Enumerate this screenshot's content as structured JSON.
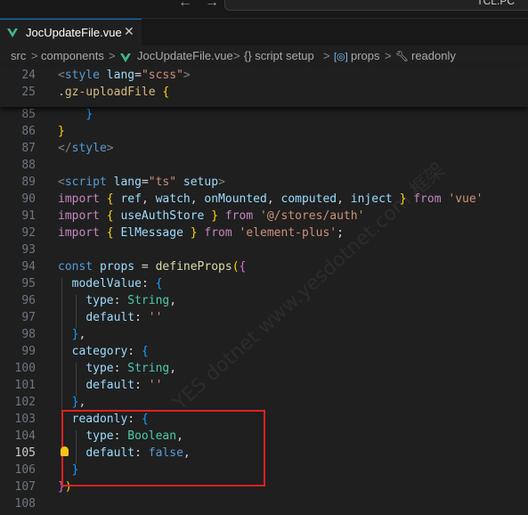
{
  "topbar": {
    "nav_back": "←",
    "nav_forward": "→",
    "command_text": "TCL.PC"
  },
  "tab": {
    "label": "JocUpdateFile.vue",
    "close": "✕"
  },
  "breadcrumb": {
    "segments": [
      "src",
      "components",
      "JocUpdateFile.vue",
      "{} script setup",
      "props",
      "readonly"
    ],
    "separator": ">"
  },
  "sticky_lines": [
    {
      "num": "24",
      "tokens": [
        [
          "t-punc",
          "<"
        ],
        [
          "t-tag",
          "style"
        ],
        [
          "t-plain",
          " "
        ],
        [
          "t-attr",
          "lang"
        ],
        [
          "t-plain",
          "="
        ],
        [
          "t-str",
          "\"scss\""
        ],
        [
          "t-punc",
          ">"
        ]
      ]
    },
    {
      "num": "25",
      "tokens": [
        [
          "t-sel",
          ".gz-uploadFile"
        ],
        [
          "t-plain",
          " "
        ],
        [
          "t-b1",
          "{"
        ]
      ]
    }
  ],
  "lines": [
    {
      "num": "85",
      "tokens": [
        [
          "t-plain",
          "    "
        ],
        [
          "t-b3",
          "}"
        ]
      ]
    },
    {
      "num": "86",
      "tokens": [
        [
          "t-b1",
          "}"
        ]
      ]
    },
    {
      "num": "87",
      "tokens": [
        [
          "t-punc",
          "</"
        ],
        [
          "t-tag",
          "style"
        ],
        [
          "t-punc",
          ">"
        ]
      ]
    },
    {
      "num": "88",
      "tokens": []
    },
    {
      "num": "89",
      "tokens": [
        [
          "t-punc",
          "<"
        ],
        [
          "t-tag",
          "script"
        ],
        [
          "t-plain",
          " "
        ],
        [
          "t-attr",
          "lang"
        ],
        [
          "t-plain",
          "="
        ],
        [
          "t-str",
          "\"ts\""
        ],
        [
          "t-plain",
          " "
        ],
        [
          "t-attr",
          "setup"
        ],
        [
          "t-punc",
          ">"
        ]
      ]
    },
    {
      "num": "90",
      "tokens": [
        [
          "t-kw",
          "import"
        ],
        [
          "t-plain",
          " "
        ],
        [
          "t-b1",
          "{"
        ],
        [
          "t-plain",
          " "
        ],
        [
          "t-var",
          "ref"
        ],
        [
          "t-plain",
          ", "
        ],
        [
          "t-var",
          "watch"
        ],
        [
          "t-plain",
          ", "
        ],
        [
          "t-var",
          "onMounted"
        ],
        [
          "t-plain",
          ", "
        ],
        [
          "t-var",
          "computed"
        ],
        [
          "t-plain",
          ", "
        ],
        [
          "t-var",
          "inject"
        ],
        [
          "t-plain",
          " "
        ],
        [
          "t-b1",
          "}"
        ],
        [
          "t-plain",
          " "
        ],
        [
          "t-kw",
          "from"
        ],
        [
          "t-plain",
          " "
        ],
        [
          "t-str",
          "'vue'"
        ]
      ]
    },
    {
      "num": "91",
      "tokens": [
        [
          "t-kw",
          "import"
        ],
        [
          "t-plain",
          " "
        ],
        [
          "t-b1",
          "{"
        ],
        [
          "t-plain",
          " "
        ],
        [
          "t-var",
          "useAuthStore"
        ],
        [
          "t-plain",
          " "
        ],
        [
          "t-b1",
          "}"
        ],
        [
          "t-plain",
          " "
        ],
        [
          "t-kw",
          "from"
        ],
        [
          "t-plain",
          " "
        ],
        [
          "t-str",
          "'@/stores/auth'"
        ]
      ]
    },
    {
      "num": "92",
      "tokens": [
        [
          "t-kw",
          "import"
        ],
        [
          "t-plain",
          " "
        ],
        [
          "t-b1",
          "{"
        ],
        [
          "t-plain",
          " "
        ],
        [
          "t-var",
          "ElMessage"
        ],
        [
          "t-plain",
          " "
        ],
        [
          "t-b1",
          "}"
        ],
        [
          "t-plain",
          " "
        ],
        [
          "t-kw",
          "from"
        ],
        [
          "t-plain",
          " "
        ],
        [
          "t-str",
          "'element-plus'"
        ],
        [
          "t-plain",
          ";"
        ]
      ]
    },
    {
      "num": "93",
      "tokens": []
    },
    {
      "num": "94",
      "tokens": [
        [
          "t-tag",
          "const"
        ],
        [
          "t-plain",
          " "
        ],
        [
          "t-var",
          "props"
        ],
        [
          "t-plain",
          " = "
        ],
        [
          "t-fn",
          "defineProps"
        ],
        [
          "t-b1",
          "("
        ],
        [
          "t-b2",
          "{"
        ]
      ]
    },
    {
      "num": "95",
      "tokens": [
        [
          "t-plain",
          "  "
        ],
        [
          "t-prop",
          "modelValue"
        ],
        [
          "t-plain",
          ": "
        ],
        [
          "t-b3",
          "{"
        ]
      ]
    },
    {
      "num": "96",
      "tokens": [
        [
          "t-plain",
          "    "
        ],
        [
          "t-prop",
          "type"
        ],
        [
          "t-plain",
          ": "
        ],
        [
          "t-type",
          "String"
        ],
        [
          "t-plain",
          ","
        ]
      ]
    },
    {
      "num": "97",
      "tokens": [
        [
          "t-plain",
          "    "
        ],
        [
          "t-prop",
          "default"
        ],
        [
          "t-plain",
          ": "
        ],
        [
          "t-str",
          "''"
        ]
      ]
    },
    {
      "num": "98",
      "tokens": [
        [
          "t-plain",
          "  "
        ],
        [
          "t-b3",
          "}"
        ],
        [
          "t-plain",
          ","
        ]
      ]
    },
    {
      "num": "99",
      "tokens": [
        [
          "t-plain",
          "  "
        ],
        [
          "t-prop",
          "category"
        ],
        [
          "t-plain",
          ": "
        ],
        [
          "t-b3",
          "{"
        ]
      ]
    },
    {
      "num": "100",
      "tokens": [
        [
          "t-plain",
          "    "
        ],
        [
          "t-prop",
          "type"
        ],
        [
          "t-plain",
          ": "
        ],
        [
          "t-type",
          "String"
        ],
        [
          "t-plain",
          ","
        ]
      ]
    },
    {
      "num": "101",
      "tokens": [
        [
          "t-plain",
          "    "
        ],
        [
          "t-prop",
          "default"
        ],
        [
          "t-plain",
          ": "
        ],
        [
          "t-str",
          "''"
        ]
      ]
    },
    {
      "num": "102",
      "tokens": [
        [
          "t-plain",
          "  "
        ],
        [
          "t-b3",
          "}"
        ],
        [
          "t-plain",
          ","
        ]
      ]
    },
    {
      "num": "103",
      "tokens": [
        [
          "t-plain",
          "  "
        ],
        [
          "t-prop",
          "readonly"
        ],
        [
          "t-plain",
          ": "
        ],
        [
          "t-b3",
          "{"
        ]
      ]
    },
    {
      "num": "104",
      "tokens": [
        [
          "t-plain",
          "    "
        ],
        [
          "t-prop",
          "type"
        ],
        [
          "t-plain",
          ": "
        ],
        [
          "t-type",
          "Boolean"
        ],
        [
          "t-plain",
          ","
        ]
      ]
    },
    {
      "num": "105",
      "tokens": [
        [
          "t-plain",
          "    "
        ],
        [
          "t-prop",
          "default"
        ],
        [
          "t-plain",
          ": "
        ],
        [
          "t-bool",
          "false"
        ],
        [
          "t-plain",
          ","
        ]
      ],
      "active": true
    },
    {
      "num": "106",
      "tokens": [
        [
          "t-plain",
          "  "
        ],
        [
          "t-b3",
          "}"
        ]
      ]
    },
    {
      "num": "107",
      "tokens": [
        [
          "t-b2",
          "}"
        ],
        [
          "t-b1",
          ")"
        ]
      ]
    },
    {
      "num": "108",
      "tokens": []
    }
  ],
  "watermark": "YES dotnet www.yesdotnet.com 框架"
}
